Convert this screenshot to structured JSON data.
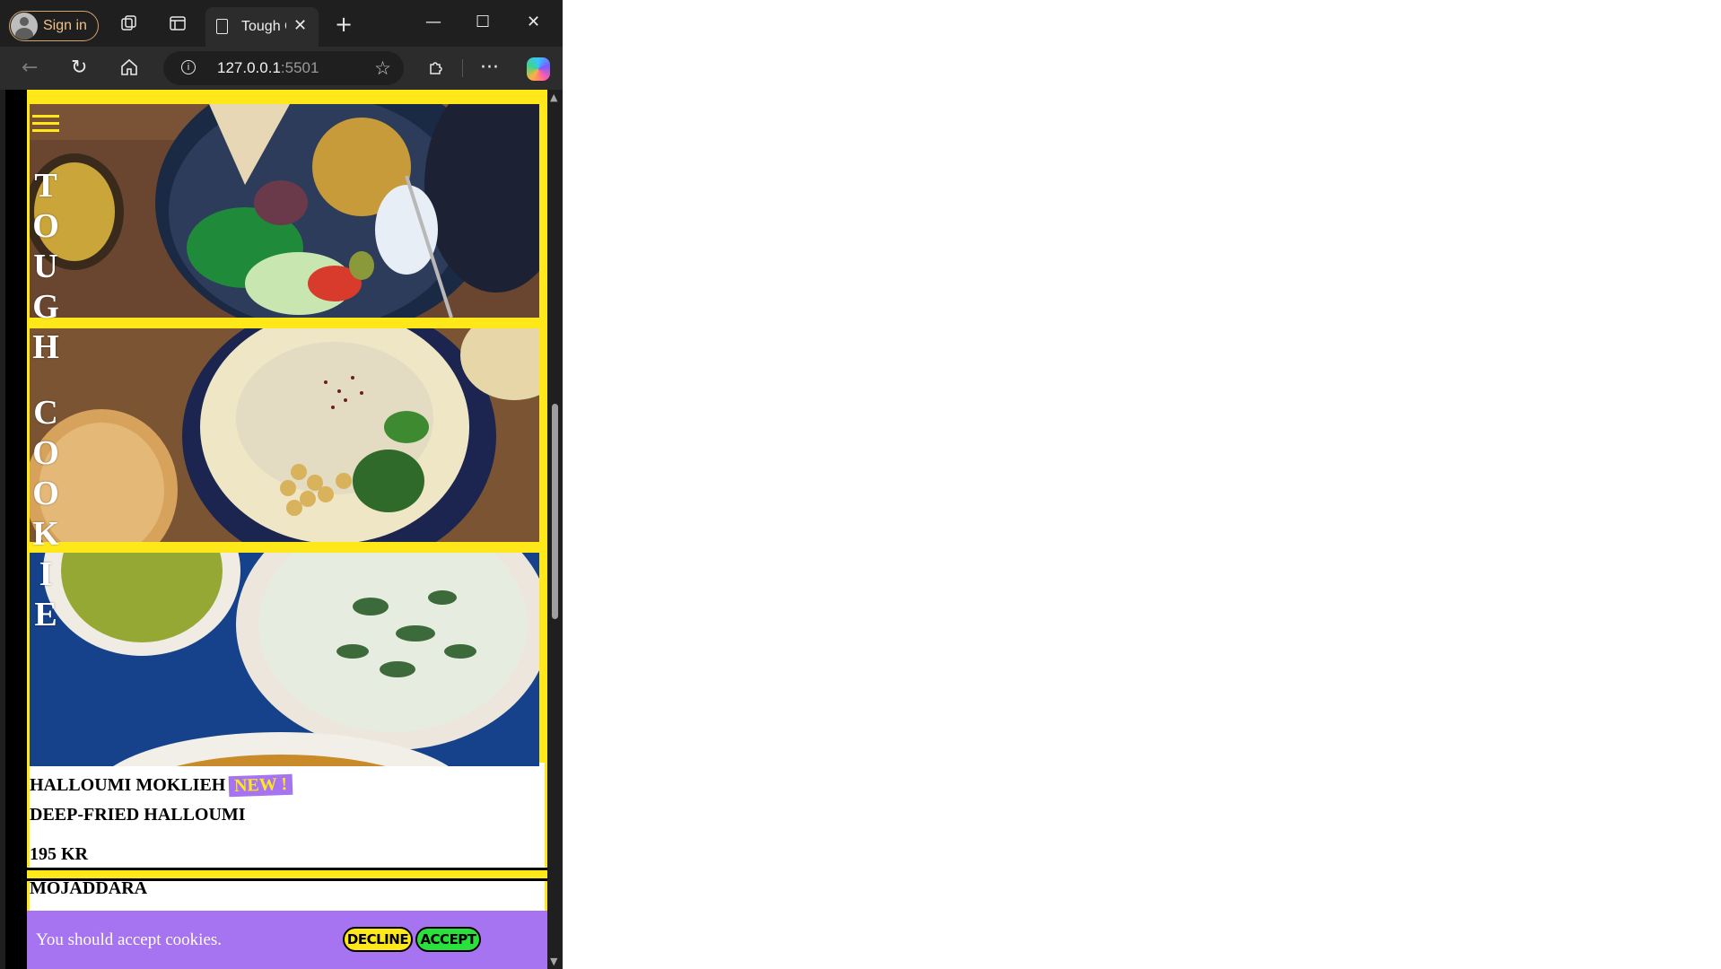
{
  "browser": {
    "signin_label": "Sign in",
    "tab_title": "Tough Cookie",
    "url_host": "127.0.0.1",
    "url_port": ":5501",
    "icons": [
      "profile-icon",
      "collections-icon",
      "vertical-tabs-icon",
      "page-icon",
      "close-tab-icon",
      "new-tab-icon",
      "minimize-icon",
      "maximize-icon",
      "close-window-icon",
      "back-icon",
      "refresh-icon",
      "home-icon",
      "info-icon",
      "favorite-star-icon",
      "extensions-icon",
      "more-icon",
      "copilot-icon"
    ]
  },
  "site": {
    "title_letters": [
      "T",
      "O",
      "U",
      "G",
      "H",
      " ",
      "C",
      "O",
      "O",
      "K",
      "I",
      "E"
    ],
    "accent_yellow": "#ffe81a",
    "accent_purple": "#a673f1",
    "accent_green": "#29e03d"
  },
  "menu": {
    "items": [
      {
        "name": "HALLOUMI MOKLIEH",
        "badge": "NEW !",
        "description": "DEEP-FRIED HALLOUMI",
        "price": "195 KR"
      },
      {
        "name": "MOJADDARA"
      }
    ]
  },
  "cookie_banner": {
    "text": "You should accept cookies.",
    "decline_label": "DECLINE",
    "accept_label": "ACCEPT"
  }
}
